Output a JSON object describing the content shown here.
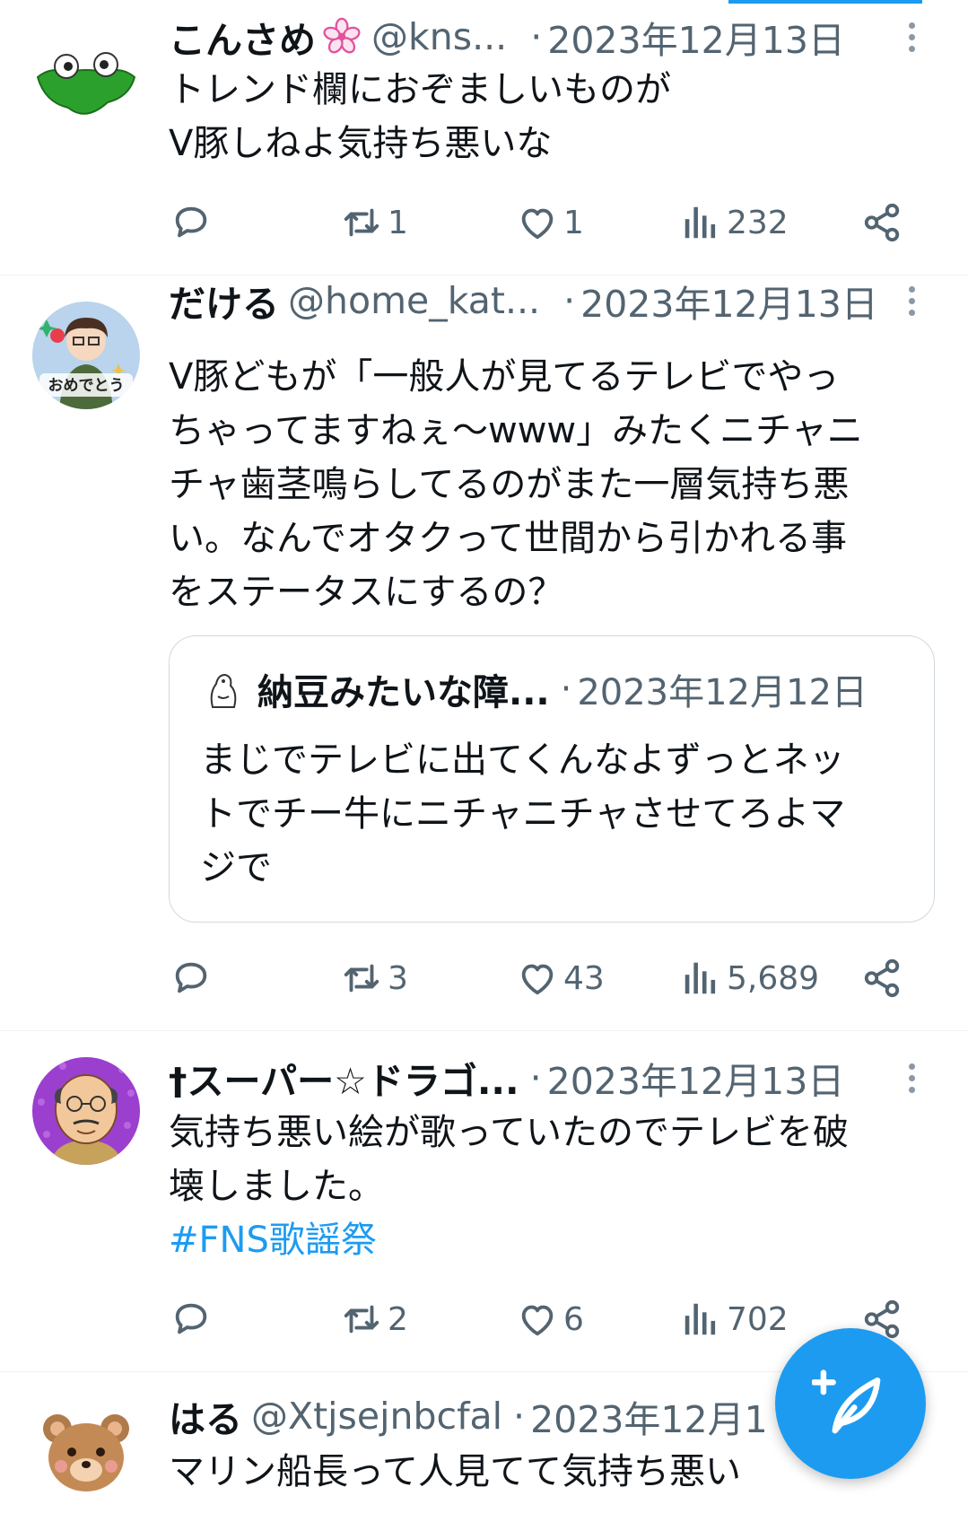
{
  "tweets": [
    {
      "name": "こんさめ",
      "handle": "@kns...",
      "dot": "·",
      "date": "2023年12月13日",
      "text_lines": [
        "トレンド欄におぞましいものが",
        "V豚しねよ気持ち悪いな"
      ],
      "retweets": "1",
      "likes": "1",
      "views": "232"
    },
    {
      "name": "だける",
      "handle": "@home_kat...",
      "dot": "·",
      "date": "2023年12月13日",
      "text_lines": [
        "V豚どもが「一般人が見てるテレビでやっ",
        "ちゃってますねぇ〜www」みたくニチャニ",
        "チャ歯茎鳴らしてるのがまた一層気持ち悪",
        "い。なんでオタクって世間から引かれる事",
        "をステータスにするの？"
      ],
      "quote": {
        "name": "納豆みたいな障...",
        "dot": "·",
        "date": "2023年12月12日",
        "text_lines": [
          "まじでテレビに出てくんなよずっとネッ",
          "トでチー牛にニチャニチャさせてろよマ",
          "ジで"
        ]
      },
      "retweets": "3",
      "likes": "43",
      "views": "5,689"
    },
    {
      "name": "†スーパー☆ドラゴ...",
      "dot": "·",
      "date": "2023年12月13日",
      "text_lines": [
        "気持ち悪い絵が歌っていたのでテレビを破",
        "壊しました。"
      ],
      "hashtag": "#FNS歌謡祭",
      "retweets": "2",
      "likes": "6",
      "views": "702"
    },
    {
      "name": "はる",
      "handle": "@Xtjsejnbcfal",
      "dot": "·",
      "date": "2023年12月1",
      "text_lines": [
        "マリン船長って人見てて気持ち悪い"
      ]
    }
  ],
  "icons": {
    "reply": "reply-icon",
    "retweet": "retweet-icon",
    "like": "heart-icon",
    "views": "views-icon",
    "share": "share-icon",
    "more": "more-vertical-icon",
    "compose": "compose-feather-icon",
    "sakura": "sakura-emoji-icon"
  },
  "colors": {
    "accent": "#1d9bf0",
    "text": "#0f1419",
    "secondary": "#536471",
    "divider": "#eff3f4"
  }
}
